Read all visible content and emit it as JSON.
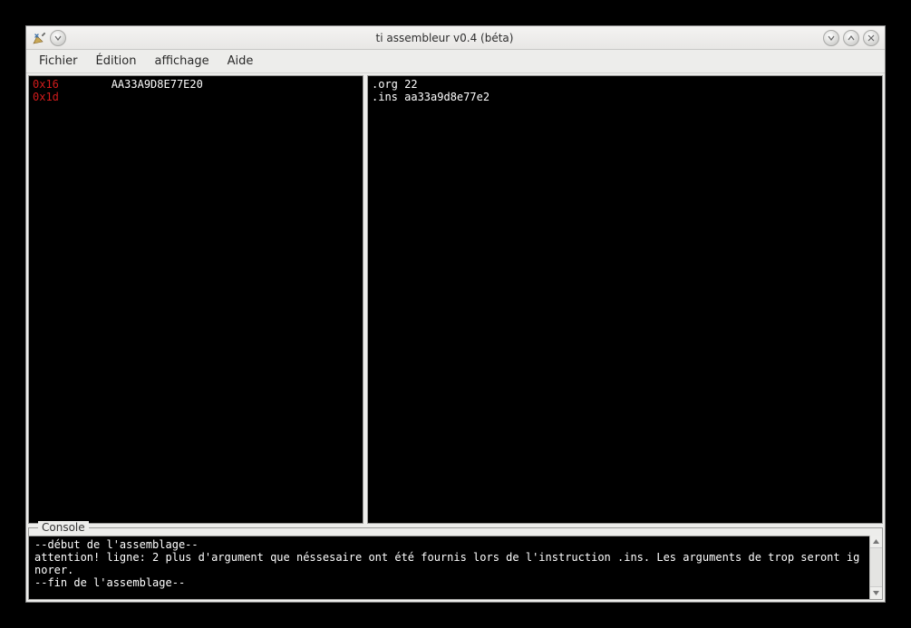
{
  "window": {
    "title": "ti assembleur v0.4 (béta)"
  },
  "menu": {
    "file": "Fichier",
    "edit": "Édition",
    "view": "affichage",
    "help": "Aide"
  },
  "left_pane": {
    "lines": [
      {
        "addr": "0x16",
        "hex": "AA33A9D8E77E20"
      },
      {
        "addr": "0x1d",
        "hex": ""
      }
    ]
  },
  "right_pane": {
    "lines": [
      ".org 22",
      ".ins aa33a9d8e77e2"
    ]
  },
  "console": {
    "label": "Console",
    "lines": [
      "--début de l'assemblage--",
      "attention! ligne: 2 plus d'argument que néssesaire ont été fournis lors de l'instruction .ins. Les arguments de trop seront ignorer.",
      "--fin de l'assemblage--"
    ]
  }
}
